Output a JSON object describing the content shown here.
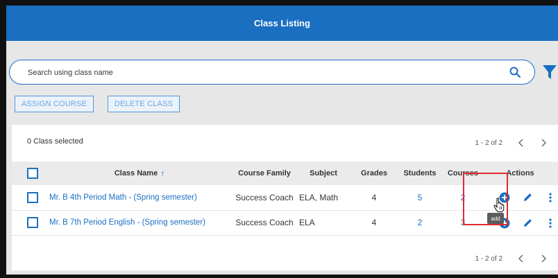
{
  "header": {
    "title": "Class Listing"
  },
  "search": {
    "placeholder": "Search using class name",
    "value": ""
  },
  "toolbar": {
    "assign_label": "ASSIGN COURSE",
    "delete_label": "DELETE CLASS"
  },
  "selection": {
    "text": "0 Class selected"
  },
  "pagination": {
    "range": "1 - 2 of 2"
  },
  "table": {
    "columns": {
      "name": "Class Name",
      "family": "Course Family",
      "subject": "Subject",
      "grades": "Grades",
      "students": "Students",
      "courses": "Courses",
      "actions": "Actions"
    },
    "sort_indicator": "↑",
    "rows": [
      {
        "name": "Mr. B 4th Period Math - (Spring semester)",
        "family": "Success Coach",
        "subject": "ELA, Math",
        "grades": "4",
        "students": "5",
        "courses": "2"
      },
      {
        "name": "Mr. B 7th Period English - (Spring semester)",
        "family": "Success Coach",
        "subject": "ELA",
        "grades": "4",
        "students": "2",
        "courses": "3"
      }
    ]
  },
  "tooltip": {
    "text": "add"
  },
  "icons": {
    "search": "search-icon",
    "filter": "filter-icon",
    "add": "add-circle-icon",
    "edit": "pencil-icon",
    "more": "more-vertical-icon",
    "prev": "chevron-left-icon",
    "next": "chevron-right-icon"
  },
  "colors": {
    "primary": "#1a6fc1",
    "highlight": "#e0282e",
    "background": "#e7e7e7"
  }
}
